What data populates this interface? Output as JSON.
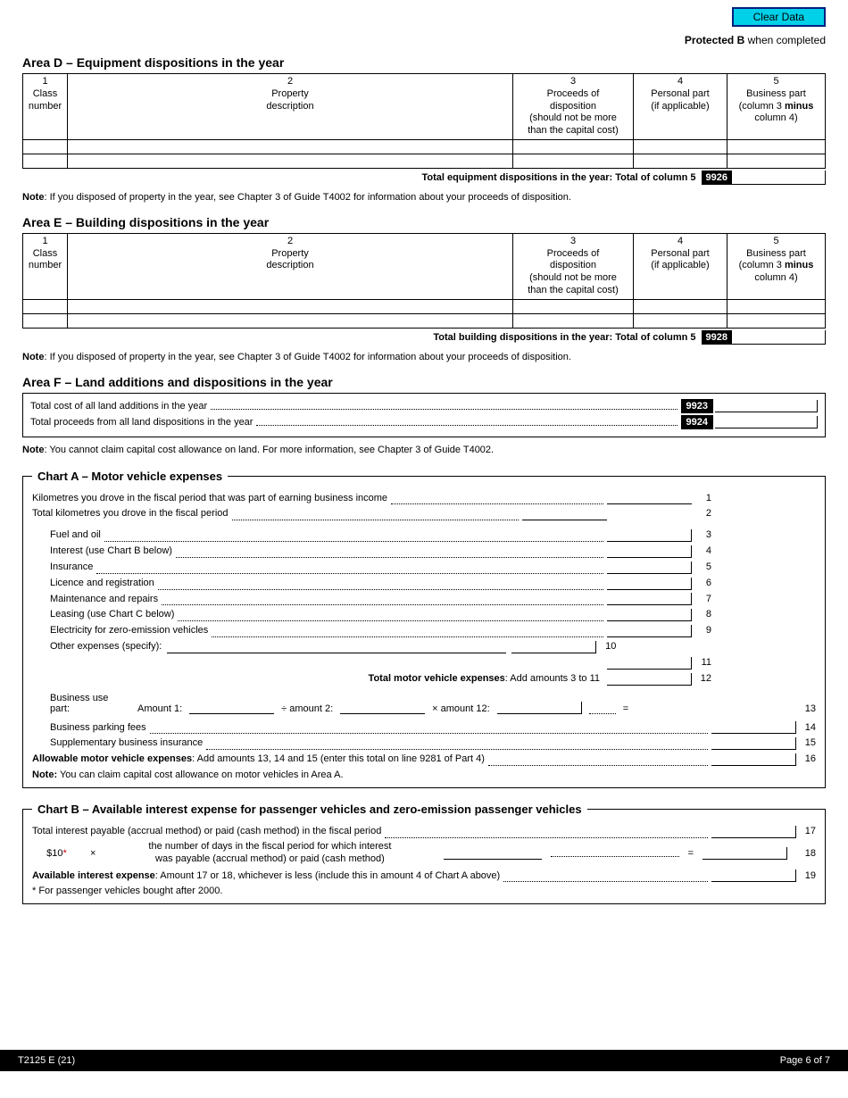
{
  "clearButton": "Clear Data",
  "protected": {
    "label": "Protected B",
    "suffix": " when completed"
  },
  "areaD": {
    "title": "Area D – Equipment dispositions in the year",
    "cols": {
      "c1a": "1",
      "c1b": "Class",
      "c1c": "number",
      "c2a": "2",
      "c2b": "Property",
      "c2c": "description",
      "c3a": "3",
      "c3b": "Proceeds of",
      "c3c": "disposition",
      "c3d": "(should not be more",
      "c3e": "than the capital cost)",
      "c4a": "4",
      "c4b": "Personal part",
      "c4c": "(if applicable)",
      "c5a": "5",
      "c5b": "Business part",
      "c5c": "(column 3 ",
      "c5d": "minus",
      "c5e": " column 4)"
    },
    "totalLabel": "Total equipment dispositions in the year: Total of column 5",
    "totalCode": "9926",
    "note": "If you disposed of property in the year, see Chapter 3 of Guide T4002 for information about your proceeds of disposition."
  },
  "areaE": {
    "title": "Area E – Building dispositions in the year",
    "totalLabel": "Total building dispositions in the year: Total of column 5",
    "totalCode": "9928",
    "note": "If you disposed of property in the year, see Chapter 3 of Guide T4002 for information about your proceeds of disposition."
  },
  "areaF": {
    "title": "Area F – Land additions and dispositions in the year",
    "line1": "Total cost of all land additions in the year",
    "code1": "9923",
    "line2": "Total proceeds from all land dispositions in the year",
    "code2": "9924",
    "note": "You cannot claim capital cost allowance on land. For more information, see Chapter 3 of Guide T4002."
  },
  "chartA": {
    "title": "Chart A – Motor vehicle expenses",
    "l1": "Kilometres you drove in the fiscal period that was part of earning business income",
    "l2": "Total kilometres you drove in the fiscal period",
    "l3": "Fuel and oil",
    "l4": "Interest (use Chart B below)",
    "l5": "Insurance",
    "l6": "Licence and registration",
    "l7": "Maintenance and repairs",
    "l8": "Leasing (use Chart C below)",
    "l9": "Electricity for zero-emission vehicles",
    "l10a": "Other expenses (specify):",
    "l12pre": "Total motor vehicle expenses",
    "l12suf": ": Add amounts 3 to 11",
    "busA": "Business use",
    "busB": "part:",
    "amt1": "Amount 1:",
    "div": "÷   amount 2:",
    "mul": "×   amount 12:",
    "eq": "=",
    "l14": "Business parking fees",
    "l15": "Supplementary business insurance",
    "l16a": "Allowable motor vehicle expenses",
    "l16b": ": Add amounts 13, 14 and 15 (enter this total on line 9281 of Part 4)",
    "noteA": "Note:",
    "noteB": " You can claim capital cost allowance on motor vehicles in Area A.",
    "n1": "1",
    "n2": "2",
    "n3": "3",
    "n4": "4",
    "n5": "5",
    "n6": "6",
    "n7": "7",
    "n8": "8",
    "n9": "9",
    "n10": "10",
    "n11": "11",
    "n12": "12",
    "n13": "13",
    "n14": "14",
    "n15": "15",
    "n16": "16"
  },
  "chartB": {
    "title": "Chart B – Available interest expense for passenger vehicles and zero-emission passenger vehicles",
    "l17": "Total interest payable (accrual method) or paid (cash method) in the fiscal period",
    "amt": "$10",
    "star": "*",
    "x": "×",
    "desc1": "the number of days in the fiscal period for which interest",
    "desc2": "was payable (accrual method) or paid (cash method)",
    "eq": "=",
    "l19a": "Available interest expense",
    "l19b": ": Amount 17 or 18, whichever is less (include this in amount 4 of Chart A above)",
    "foot": "* For passenger vehicles bought after 2000.",
    "n17": "17",
    "n18": "18",
    "n19": "19"
  },
  "footer": {
    "left": "T2125 E (21)",
    "right": "Page 6 of 7"
  }
}
